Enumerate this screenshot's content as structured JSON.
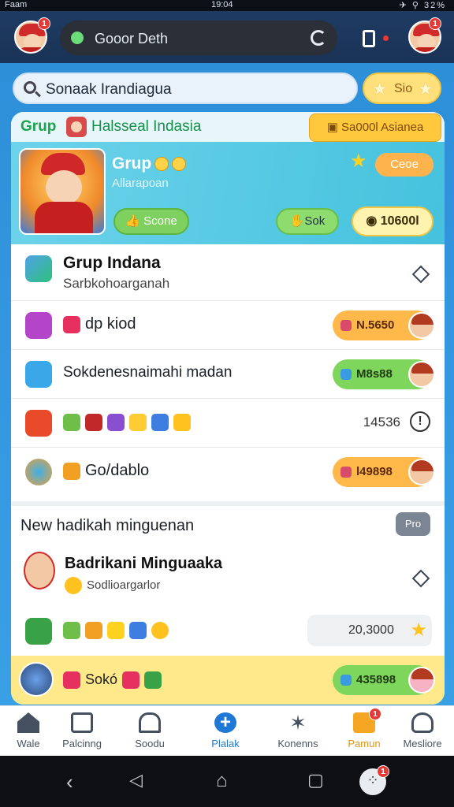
{
  "status_bar": {
    "left": "Faam",
    "time": "19:04",
    "right": "✈ ⚲ 32%"
  },
  "topbar": {
    "search_text": "Gooor Deth",
    "left_badge": "1",
    "right_badge": "1"
  },
  "search": {
    "placeholder": "Sonaak Irandiagua",
    "star_label": "Sio"
  },
  "group": {
    "tag": "Grup",
    "title": "Halsseal Indasia",
    "action_label": "Sa000l Asianea"
  },
  "hero": {
    "title": "Grup",
    "subtitle": "Allarapoan",
    "code_label": "Ceoe",
    "btn_score": "Scone",
    "btn_sok": "Sok",
    "btn_total": "10600l"
  },
  "list": [
    {
      "title": "Grup Indana",
      "subtitle": "Sarbkohoarganah"
    },
    {
      "label": "dp kiod",
      "amount": "N.5650",
      "amount_color": "#ffb84a"
    },
    {
      "label": "Sokdenesnaimahi madan",
      "amount": "M8s88",
      "amount_color": "#7ed65c"
    },
    {
      "label": "",
      "amount": "14536"
    },
    {
      "label": "Go/dablo",
      "amount": "l49898",
      "amount_color": "#ffb84a"
    }
  ],
  "section": {
    "heading": "New hadikah minguenan",
    "vip_label": "Pro",
    "item_title": "Badrikani Minguaaka",
    "item_subtitle": "Sodlioargarlor",
    "item_amount": "20,3000"
  },
  "bottom_band": {
    "label": "Sokó",
    "amount": "435898"
  },
  "nav": [
    {
      "label": "Wale",
      "icon": "home-icon"
    },
    {
      "label": "Palcinng",
      "icon": "calendar-icon"
    },
    {
      "label": "Soodu",
      "icon": "building-icon"
    },
    {
      "label": "Plalak",
      "icon": "plus-icon",
      "active": true
    },
    {
      "label": "Konenns",
      "icon": "star-burst-icon"
    },
    {
      "label": "Pamun",
      "icon": "bag-icon",
      "badge": "1"
    },
    {
      "label": "Mesliore",
      "icon": "user-icon"
    }
  ],
  "sys_badge": "1"
}
